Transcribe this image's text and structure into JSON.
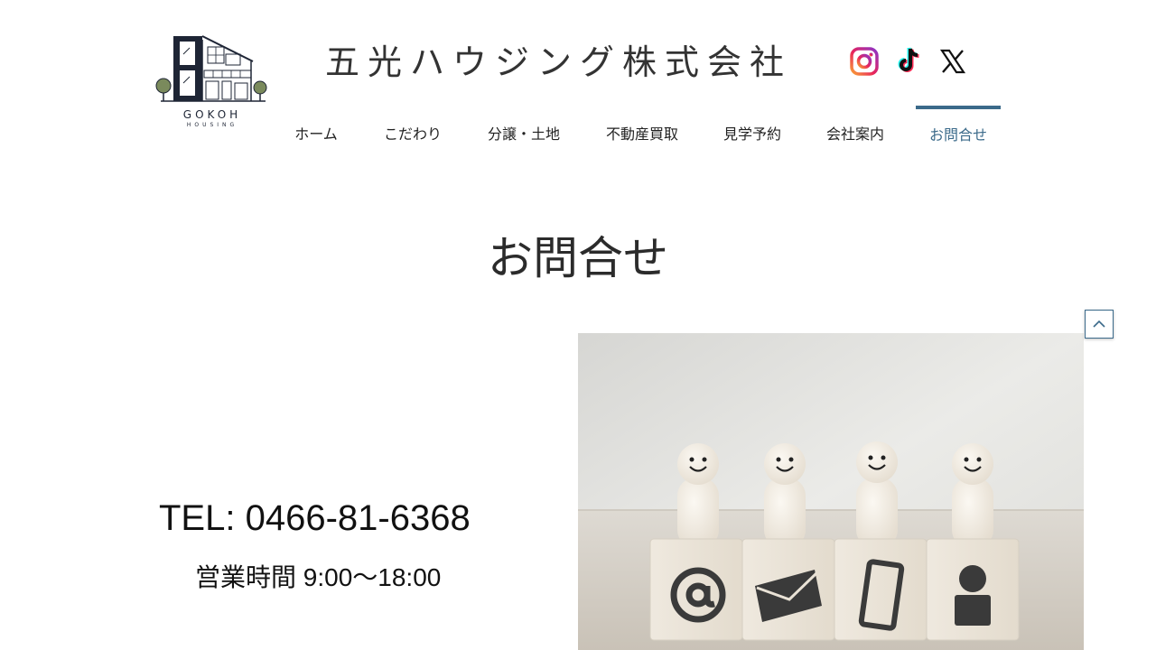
{
  "logo": {
    "name": "GOKOH",
    "sub": "HOUSING"
  },
  "company_name": "五光ハウジング株式会社",
  "social": [
    {
      "icon": "instagram-icon"
    },
    {
      "icon": "tiktok-icon"
    },
    {
      "icon": "x-icon"
    }
  ],
  "nav": {
    "items": [
      {
        "label": "ホーム"
      },
      {
        "label": "こだわり"
      },
      {
        "label": "分譲・土地"
      },
      {
        "label": "不動産買取"
      },
      {
        "label": "見学予約"
      },
      {
        "label": "会社案内"
      },
      {
        "label": "お問合せ"
      }
    ],
    "active_index": 6
  },
  "page_title": "お問合せ",
  "contact": {
    "tel": "TEL: 0466-81-6368",
    "hours": "営業時間 9:00～18:00"
  },
  "hero_image": {
    "icons": [
      "at-icon",
      "envelope-icon",
      "smartphone-icon",
      "person-icon"
    ]
  },
  "scroll_top": {
    "icon": "chevron-up-icon"
  },
  "colors": {
    "accent": "#3b6a8a",
    "text": "#222222",
    "logo": "#1e2535"
  }
}
